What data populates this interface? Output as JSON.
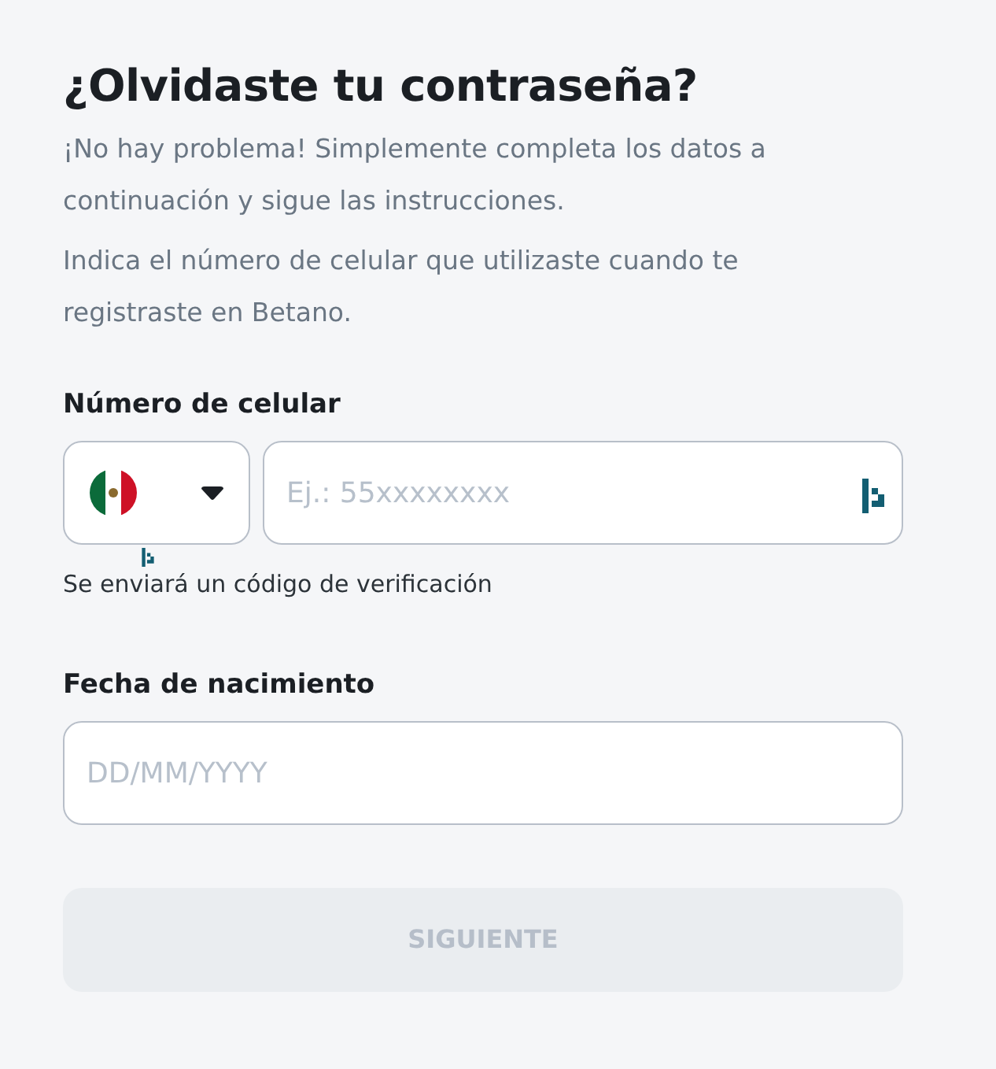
{
  "title": "¿Olvidaste tu contraseña?",
  "paragraphs": [
    "¡No hay problema! Simplemente completa los datos a continuación y sigue las instrucciones.",
    "Indica el número de celular que utilizaste cuando te registraste en Betano."
  ],
  "phone": {
    "label": "Número de celular",
    "placeholder": "Ej.: 55xxxxxxxx",
    "hint": "Se enviará un código de verificación"
  },
  "birthdate": {
    "label": "Fecha de nacimiento",
    "placeholder": "DD/MM/YYYY"
  },
  "submit": {
    "label": "SIGUIENTE",
    "disabled": true
  }
}
